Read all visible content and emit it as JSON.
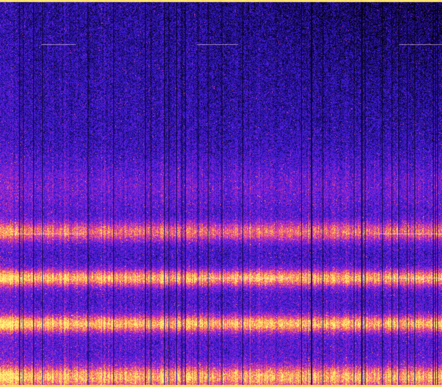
{
  "image": {
    "kind": "spectrogram",
    "colormap": [
      "#000000",
      "#1a0a6e",
      "#3a1ee0",
      "#8a20d8",
      "#e03aa0",
      "#ff8a40",
      "#fff27a"
    ],
    "background_color": "#1a0a6e",
    "top_edge_color": "#fff27a",
    "bottom_edge_color": "#fff27a"
  }
}
